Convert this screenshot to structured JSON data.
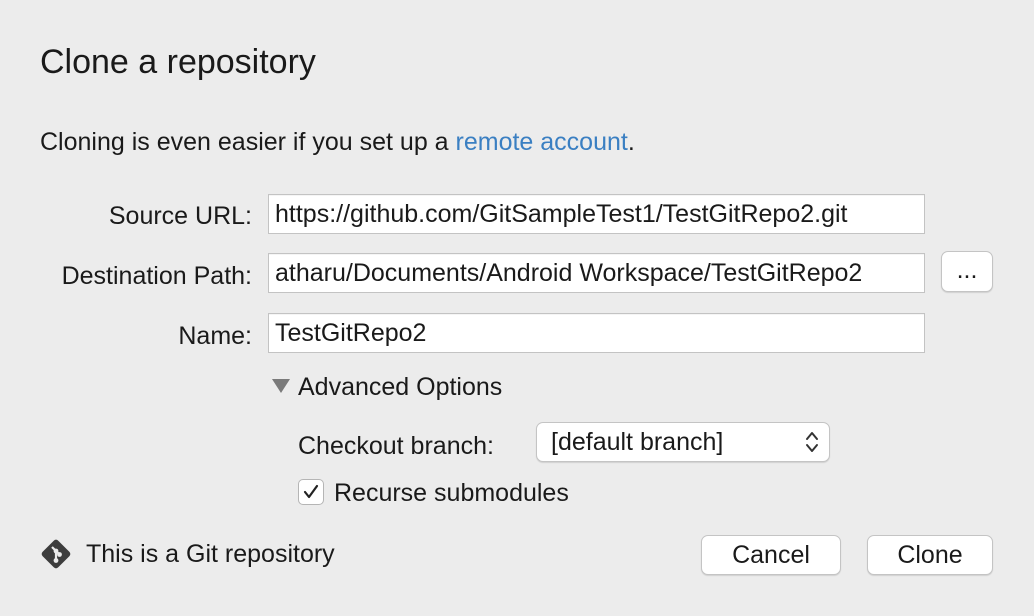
{
  "dialog": {
    "title": "Clone a repository",
    "intro_prefix": "Cloning is even easier if you set up a ",
    "intro_link": "remote account",
    "intro_suffix": "."
  },
  "form": {
    "source_url": {
      "label": "Source URL:",
      "value": "https://github.com/GitSampleTest1/TestGitRepo2.git"
    },
    "destination_path": {
      "label": "Destination Path:",
      "value": "atharu/Documents/Android Workspace/TestGitRepo2",
      "browse_label": "..."
    },
    "name": {
      "label": "Name:",
      "value": "TestGitRepo2"
    }
  },
  "advanced": {
    "toggle_label": "Advanced Options",
    "expanded": true,
    "checkout_branch": {
      "label": "Checkout branch:",
      "selected": "[default branch]"
    },
    "recurse_submodules": {
      "label": "Recurse submodules",
      "checked": true
    }
  },
  "footer": {
    "status_text": "This is a Git repository",
    "status_icon": "git-icon",
    "cancel_label": "Cancel",
    "clone_label": "Clone"
  },
  "colors": {
    "background": "#ececec",
    "link": "#3a7fc2",
    "git_icon": "#3d3d3d"
  }
}
